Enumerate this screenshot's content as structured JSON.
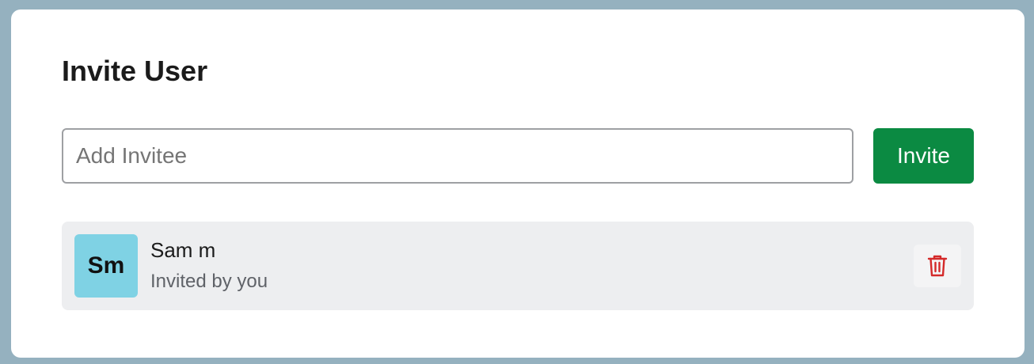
{
  "dialog": {
    "title": "Invite User",
    "input": {
      "placeholder": "Add Invitee",
      "value": ""
    },
    "invite_label": "Invite"
  },
  "invitees": [
    {
      "initials": "Sm",
      "name": "Sam m",
      "status": "Invited by you",
      "delete_icon": "trash-icon"
    }
  ],
  "colors": {
    "backdrop": "#95b1bf",
    "primary": "#0b8a42",
    "avatar": "#7fd2e4",
    "danger": "#d42a2a",
    "row_background": "#edeef0"
  }
}
